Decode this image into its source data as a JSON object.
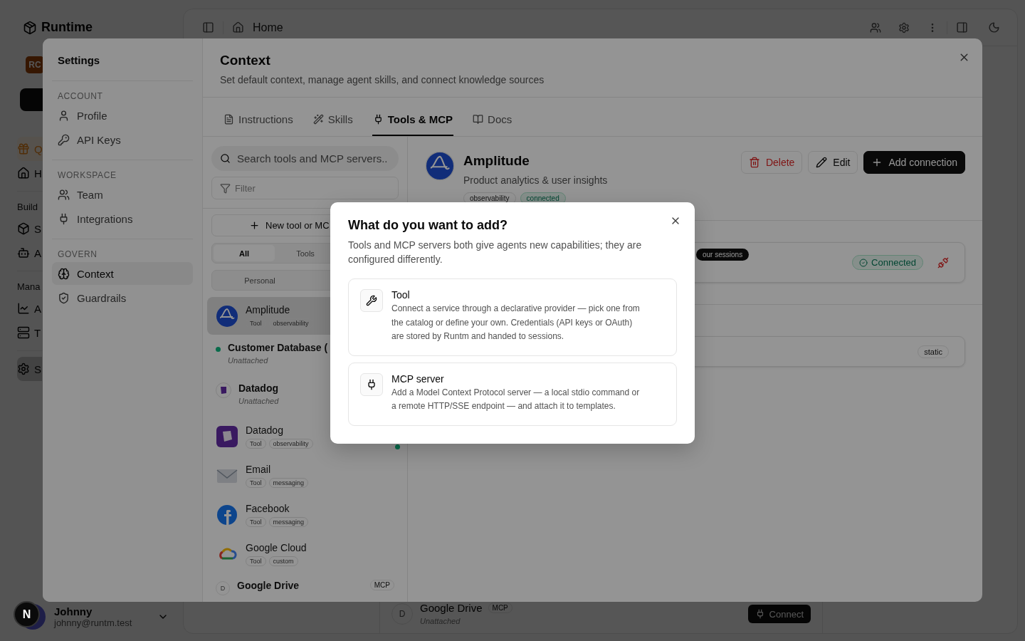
{
  "app": {
    "brand": "Runtime",
    "org_badge": "RC",
    "nav": [
      {
        "items": [
          {
            "kind": "promo",
            "label": "Q",
            "selected": false
          },
          {
            "kind": "link",
            "label": "H",
            "selected": false
          }
        ]
      },
      {
        "heading": "Build",
        "items": [
          {
            "kind": "link",
            "label": "S",
            "selected": false
          },
          {
            "kind": "link",
            "label": "A",
            "selected": false
          }
        ]
      },
      {
        "heading": "Mana",
        "items": [
          {
            "kind": "link",
            "label": "A",
            "selected": false
          },
          {
            "kind": "link",
            "label": "T",
            "selected": false
          }
        ]
      },
      {
        "items": [
          {
            "kind": "link",
            "label": "S",
            "selected": true
          }
        ]
      }
    ],
    "user": {
      "name": "Johnny",
      "email": "johnny@runtm.test"
    },
    "breadcrumb": "Home",
    "background_row": {
      "letter": "D",
      "name": "Google Drive",
      "badge": "MCP",
      "status": "Unattached",
      "action": "Connect"
    }
  },
  "dev_badge": "N",
  "settings": {
    "title": "Settings",
    "sections": [
      {
        "heading": "ACCOUNT",
        "items": [
          {
            "label": "Profile",
            "selected": false
          },
          {
            "label": "API Keys",
            "selected": false
          }
        ]
      },
      {
        "heading": "WORKSPACE",
        "items": [
          {
            "label": "Team",
            "selected": false
          },
          {
            "label": "Integrations",
            "selected": false
          }
        ]
      },
      {
        "heading": "GOVERN",
        "items": [
          {
            "label": "Context",
            "selected": true
          },
          {
            "label": "Guardrails",
            "selected": false
          }
        ]
      }
    ],
    "page_title": "Context",
    "page_subtitle": "Set default context, manage agent skills, and connect knowledge sources",
    "tabs": [
      {
        "label": "Instructions",
        "selected": false
      },
      {
        "label": "Skills",
        "selected": false
      },
      {
        "label": "Tools & MCP",
        "selected": true
      },
      {
        "label": "Docs",
        "selected": false
      }
    ],
    "search": {
      "placeholder": "Search tools and MCP servers.."
    },
    "filter": {
      "placeholder": "Filter"
    },
    "new_button": "New tool or MC",
    "type_segments": [
      {
        "label": "All",
        "selected": true
      },
      {
        "label": "Tools",
        "selected": false
      }
    ],
    "scope_segments": [
      {
        "label": "Personal",
        "selected": false
      }
    ],
    "items": [
      {
        "kind": "tool",
        "name": "Amplitude",
        "tags": [
          "Tool",
          "observability"
        ],
        "selected": true,
        "active": false
      },
      {
        "kind": "status",
        "name": "Customer Database (",
        "status": "Unattached",
        "selected": false
      },
      {
        "kind": "branded",
        "name": "Datadog",
        "status": "Unattached",
        "selected": false
      },
      {
        "kind": "tool",
        "name": "Datadog",
        "tags": [
          "Tool",
          "observability"
        ],
        "selected": false,
        "active": true
      },
      {
        "kind": "tool",
        "name": "Email",
        "tags": [
          "Tool",
          "messaging"
        ],
        "selected": false,
        "active": false
      },
      {
        "kind": "tool",
        "name": "Facebook",
        "tags": [
          "Tool",
          "messaging"
        ],
        "selected": false,
        "active": false
      },
      {
        "kind": "tool",
        "name": "Google Cloud",
        "tags": [
          "Tool",
          "custom"
        ],
        "selected": false,
        "active": false
      },
      {
        "kind": "lettered",
        "letter": "D",
        "name": "Google Drive",
        "badge": "MCP",
        "selected": false
      }
    ],
    "detail": {
      "name": "Amplitude",
      "description": "Product analytics & user insights",
      "tags": [
        {
          "label": "observability",
          "kind": "plain"
        },
        {
          "label": "connected",
          "kind": "success"
        }
      ],
      "actions": [
        {
          "label": "Delete",
          "kind": "danger"
        },
        {
          "label": "Edit",
          "kind": "outline"
        },
        {
          "label": "Add connection",
          "kind": "primary"
        }
      ],
      "tooltip": "our sessions",
      "connection_status": "Connected",
      "mode_badge": "static"
    }
  },
  "dialog": {
    "title": "What do you want to add?",
    "description": "Tools and MCP servers both give agents new capabilities; they are configured differently.",
    "options": [
      {
        "kind": "tool",
        "title": "Tool",
        "description": "Connect a service through a declarative provider — pick one from the catalog or define your own. Credentials (API keys or OAuth) are stored by Runtm and handed to sessions."
      },
      {
        "kind": "mcp",
        "title": "MCP server",
        "description": "Add a Model Context Protocol server — a local stdio command or a remote HTTP/SSE endpoint — and attach it to templates."
      }
    ]
  }
}
